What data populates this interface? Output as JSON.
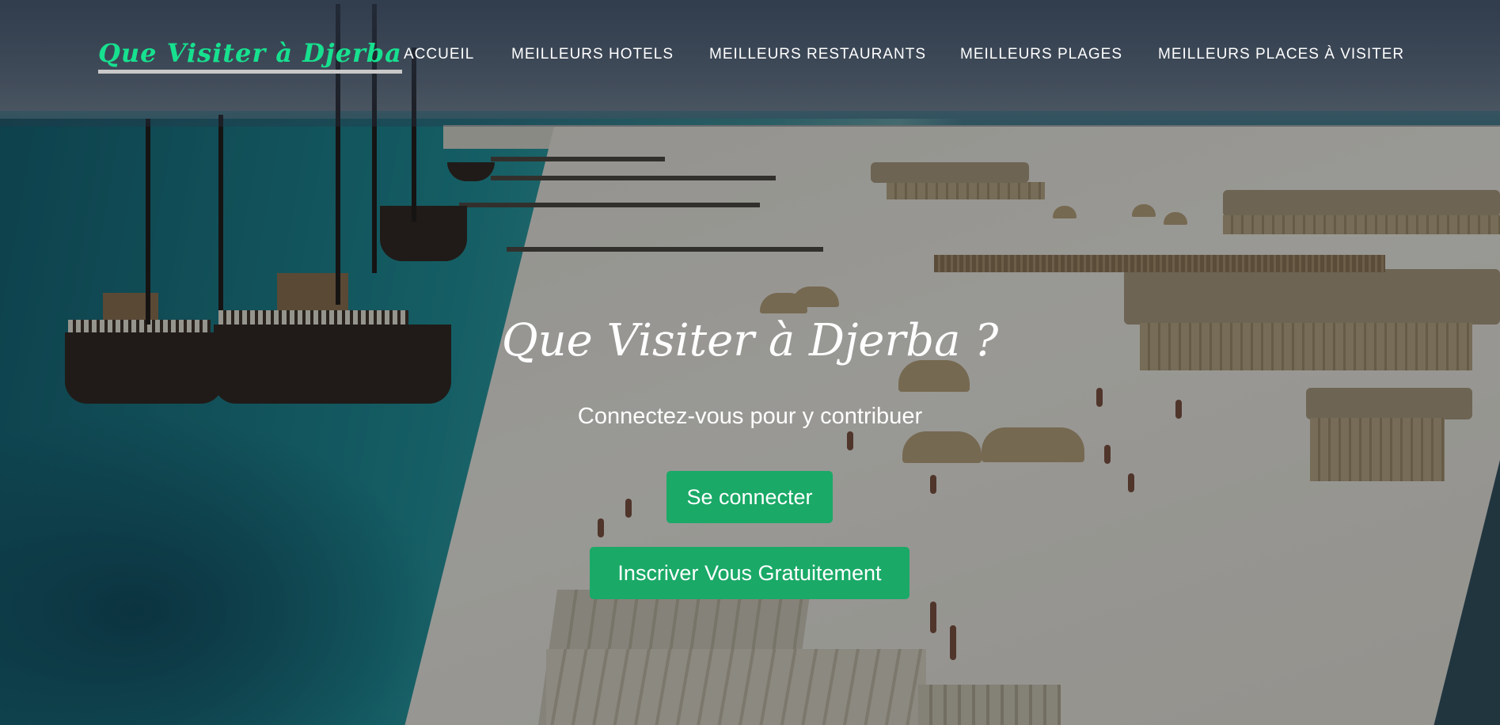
{
  "brand": {
    "name": "Que Visiter à Djerba",
    "color": "#17e08f"
  },
  "nav": {
    "items": [
      {
        "label": "ACCUEIL"
      },
      {
        "label": "MEILLEURS HOTELS"
      },
      {
        "label": "MEILLEURS RESTAURANTS"
      },
      {
        "label": "MEILLEURS PLAGES"
      },
      {
        "label": "MEILLEURS PLACES À VISITER"
      }
    ]
  },
  "hero": {
    "title": "Que Visiter à Djerba ?",
    "subtitle": "Connectez-vous pour y contribuer",
    "login_button": "Se connecter",
    "signup_button": "Inscriver Vous Gratuitement",
    "button_color": "#1aa967",
    "background": "beach-harbor-photo"
  }
}
